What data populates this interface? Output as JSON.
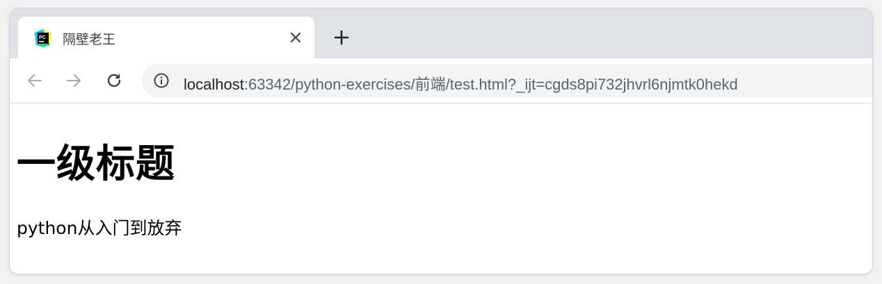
{
  "tab": {
    "title": "隔壁老王",
    "favicon": "pycharm-icon"
  },
  "toolbar": {
    "back_icon": "back-arrow-icon",
    "forward_icon": "forward-arrow-icon",
    "reload_icon": "reload-icon",
    "info_icon": "info-icon",
    "url_host": "localhost",
    "url_rest": ":63342/python-exercises/前端/test.html?_ijt=cgds8pi732jhvrl6njmtk0hekd"
  },
  "page": {
    "heading": "一级标题",
    "paragraph": "python从入门到放弃"
  },
  "colors": {
    "tabstrip": "#dee1e6",
    "omnibox": "#f1f3f4",
    "url_path": "#5f6368",
    "url_host": "#202124"
  }
}
